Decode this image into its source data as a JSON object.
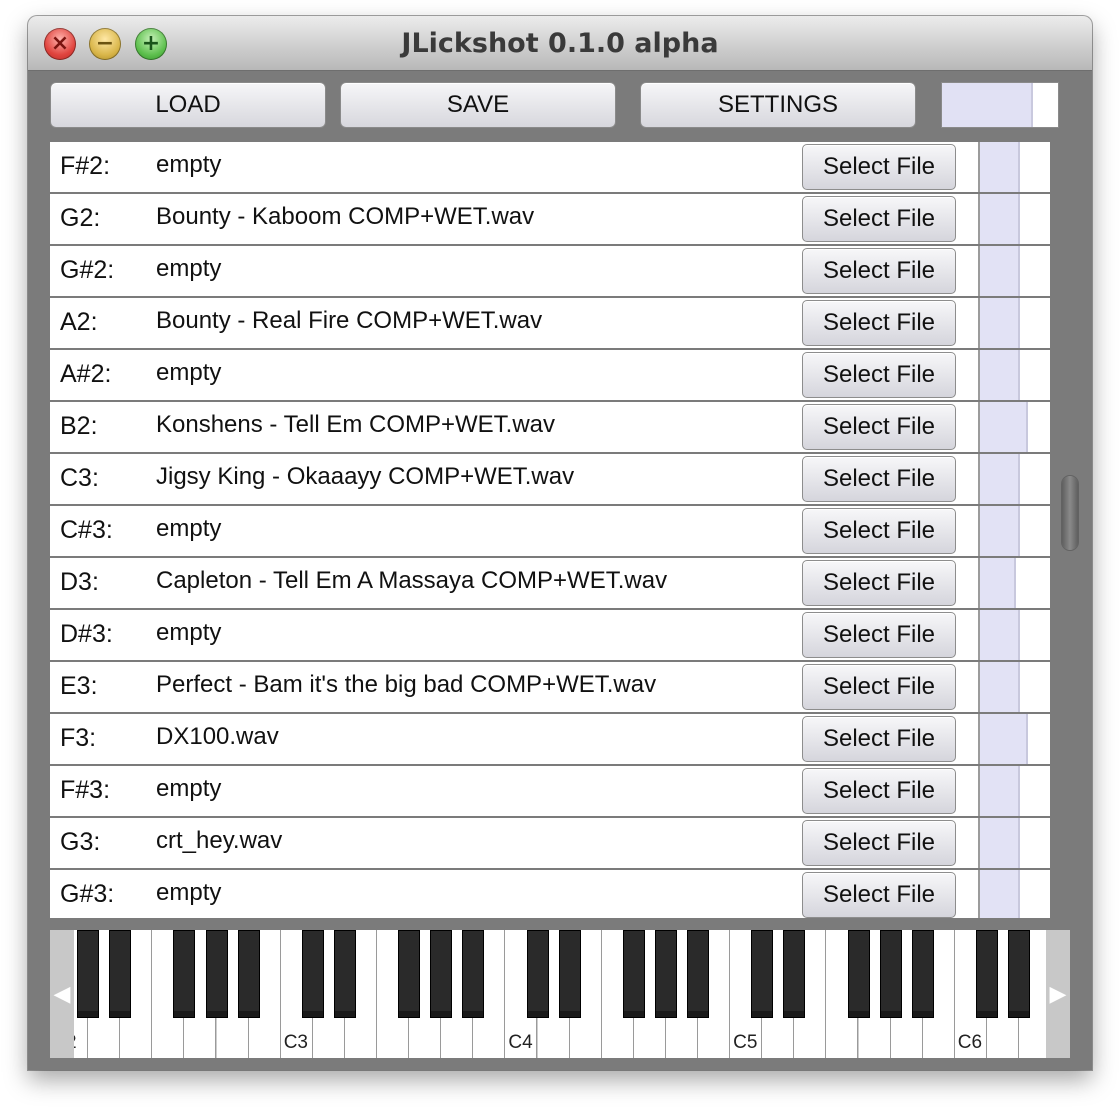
{
  "window": {
    "title": "JLickshot 0.1.0 alpha"
  },
  "toolbar": {
    "load_label": "LOAD",
    "save_label": "SAVE",
    "settings_label": "SETTINGS",
    "master_level": 0.77
  },
  "rows": [
    {
      "note": "F#2:",
      "file": "empty",
      "button": "Select File",
      "level": 0.72
    },
    {
      "note": "G2:",
      "file": "Bounty - Kaboom COMP+WET.wav",
      "button": "Select File",
      "level": 0.72
    },
    {
      "note": "G#2:",
      "file": "empty",
      "button": "Select File",
      "level": 0.72
    },
    {
      "note": "A2:",
      "file": "Bounty - Real Fire COMP+WET.wav",
      "button": "Select File",
      "level": 0.72
    },
    {
      "note": "A#2:",
      "file": "empty",
      "button": "Select File",
      "level": 0.72
    },
    {
      "note": "B2:",
      "file": "Konshens - Tell Em COMP+WET.wav",
      "button": "Select File",
      "level": 0.86
    },
    {
      "note": "C3:",
      "file": "Jigsy King - Okaaayy COMP+WET.wav",
      "button": "Select File",
      "level": 0.72
    },
    {
      "note": "C#3:",
      "file": "empty",
      "button": "Select File",
      "level": 0.72
    },
    {
      "note": "D3:",
      "file": "Capleton - Tell Em A Massaya COMP+WET.wav",
      "button": "Select File",
      "level": 0.64
    },
    {
      "note": "D#3:",
      "file": "empty",
      "button": "Select File",
      "level": 0.72
    },
    {
      "note": "E3:",
      "file": "Perfect - Bam it's the big bad COMP+WET.wav",
      "button": "Select File",
      "level": 0.72
    },
    {
      "note": "F3:",
      "file": "DX100.wav",
      "button": "Select File",
      "level": 0.86
    },
    {
      "note": "F#3:",
      "file": "empty",
      "button": "Select File",
      "level": 0.72
    },
    {
      "note": "G3:",
      "file": "crt_hey.wav",
      "button": "Select File",
      "level": 0.72
    },
    {
      "note": "G#3:",
      "file": "empty",
      "button": "Select File",
      "level": 0.72
    }
  ],
  "keyboard": {
    "left_arrow": "◀",
    "right_arrow": "▶",
    "first_label": "2",
    "octave_labels": [
      "C3",
      "C4",
      "C5",
      "C6"
    ]
  },
  "colors": {
    "window_bg": "#7b7b7b",
    "meter_fill": "#e2e2f5"
  }
}
